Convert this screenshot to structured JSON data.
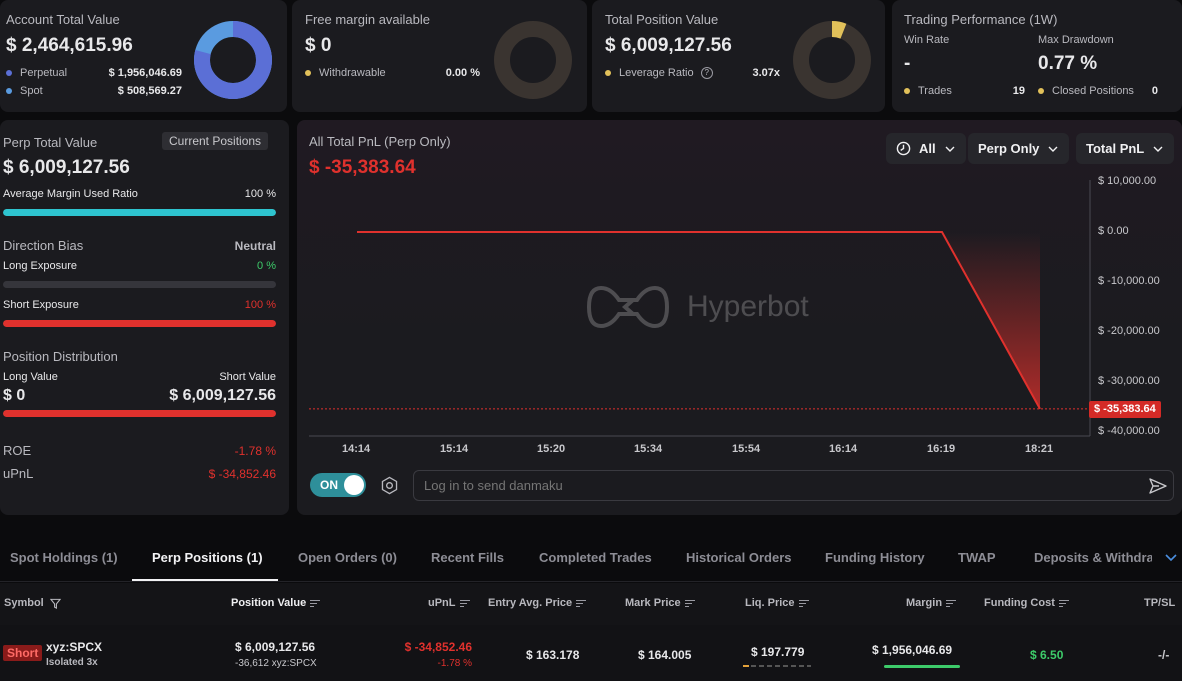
{
  "cards": {
    "account": {
      "title": "Account Total Value",
      "value": "$ 2,464,615.96",
      "perp_label": "Perpetual",
      "perp_value": "$ 1,956,046.69",
      "spot_label": "Spot",
      "spot_value": "$ 508,569.27",
      "perp_fraction": 0.79
    },
    "free_margin": {
      "title": "Free margin available",
      "value": "$ 0",
      "withdrawable_label": "Withdrawable",
      "withdrawable_value": "0.00 %",
      "fraction": 0
    },
    "position_value": {
      "title": "Total Position Value",
      "value": "$ 6,009,127.56",
      "leverage_label": "Leverage Ratio",
      "leverage_value": "3.07x",
      "fraction": 0.06
    },
    "performance": {
      "title": "Trading Performance (1W)",
      "win_rate_label": "Win Rate",
      "win_rate_value": "-",
      "drawdown_label": "Max Drawdown",
      "drawdown_value": "0.77 %",
      "trades_label": "Trades",
      "trades_value": "19",
      "closed_label": "Closed Positions",
      "closed_value": "0"
    }
  },
  "perp": {
    "title": "Perp Total Value",
    "current_positions": "Current Positions",
    "value": "$ 6,009,127.56",
    "margin_label": "Average Margin Used Ratio",
    "margin_value": "100 %",
    "margin_fraction": 1.0,
    "bias_label": "Direction Bias",
    "bias_value": "Neutral",
    "long_exp_label": "Long Exposure",
    "long_exp_value": "0 %",
    "long_fraction": 0,
    "short_exp_label": "Short Exposure",
    "short_exp_value": "100 %",
    "short_fraction": 1.0,
    "dist_label": "Position Distribution",
    "long_value_label": "Long Value",
    "short_value_label": "Short Value",
    "long_value": "$ 0",
    "short_value": "$ 6,009,127.56",
    "dist_short_fraction": 1.0,
    "roe_label": "ROE",
    "roe_value": "-1.78 %",
    "upnl_label": "uPnL",
    "upnl_value": "$ -34,852.46"
  },
  "chart_panel": {
    "title": "All Total PnL (Perp Only)",
    "value": "$ -35,383.64",
    "filter_period": "All",
    "filter_scope": "Perp Only",
    "filter_metric": "Total PnL",
    "watermark": "Hyperbot",
    "toggle_label": "ON",
    "danmaku_placeholder": "Log in to send danmaku",
    "last_label": "$ -35,383.64"
  },
  "chart_data": {
    "type": "line",
    "x": [
      "14:14",
      "15:14",
      "15:20",
      "15:34",
      "15:54",
      "16:14",
      "16:19",
      "18:21"
    ],
    "y": [
      0,
      0,
      0,
      0,
      0,
      0,
      0,
      -35383.64
    ],
    "y_ticks": [
      "$ 10,000.00",
      "$ 0.00",
      "$ -10,000.00",
      "$ -20,000.00",
      "$ -30,000.00",
      "$ -40,000.00"
    ],
    "ylim": [
      -40000,
      10000
    ],
    "grid": false,
    "color": "#e0312d"
  },
  "tabs": [
    {
      "label": "Spot Holdings (1)"
    },
    {
      "label": "Perp Positions (1)"
    },
    {
      "label": "Open Orders (0)"
    },
    {
      "label": "Recent Fills"
    },
    {
      "label": "Completed Trades"
    },
    {
      "label": "Historical Orders"
    },
    {
      "label": "Funding History"
    },
    {
      "label": "TWAP"
    },
    {
      "label": "Deposits & Withdraw"
    }
  ],
  "table": {
    "headers": {
      "symbol": "Symbol",
      "position_value": "Position Value",
      "upnl": "uPnL",
      "entry": "Entry Avg. Price",
      "mark": "Mark Price",
      "liq": "Liq. Price",
      "margin": "Margin",
      "funding": "Funding Cost",
      "tpsl": "TP/SL"
    },
    "row": {
      "side": "Short",
      "symbol": "xyz:SPCX",
      "mode": "Isolated 3x",
      "position_value": "$ 6,009,127.56",
      "size": "-36,612 xyz:SPCX",
      "upnl": "$ -34,852.46",
      "upnl_pct": "-1.78 %",
      "entry": "$ 163.178",
      "mark": "$ 164.005",
      "liq": "$ 197.779",
      "margin": "$ 1,956,046.69",
      "funding": "$ 6.50",
      "tpsl": "-/-"
    }
  },
  "colors": {
    "accent_blue": "#5b6fd6",
    "spot_blue": "#5a9be0",
    "gold": "#e2c15a",
    "red": "#e0312d",
    "green": "#3dcb6a",
    "teal": "#2ec4cf"
  }
}
